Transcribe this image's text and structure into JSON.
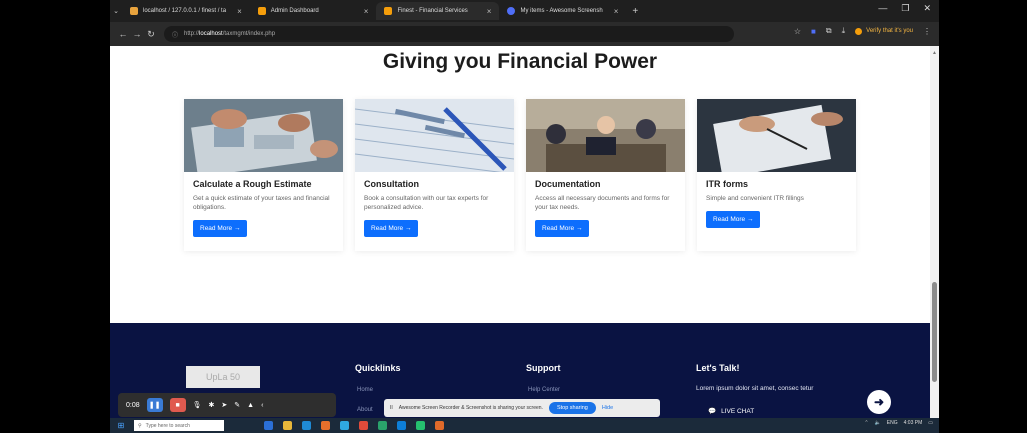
{
  "browser": {
    "tabs": [
      {
        "label": "localhost / 127.0.0.1 / finest / ta",
        "color": "#e8a33d"
      },
      {
        "label": "Admin Dashboard",
        "color": "#f59e0b"
      },
      {
        "label": "Finest - Financial Services",
        "color": "#f59e0b"
      },
      {
        "label": "My items - Awesome Screensh",
        "color": "#4f6ef7"
      }
    ],
    "url_prefix": "http://",
    "url_host": "localhost",
    "url_path": "/taxmgmt/index.php",
    "verify_label": "Verify that it's you"
  },
  "section": {
    "title": "Giving you Financial Power"
  },
  "cards": [
    {
      "title": "Calculate a Rough Estimate",
      "desc": "Get a quick estimate of your taxes and financial obligations.",
      "button": "Read More →"
    },
    {
      "title": "Consultation",
      "desc": "Book a consultation with our tax experts for personalized advice.",
      "button": "Read More →"
    },
    {
      "title": "Documentation",
      "desc": "Access all necessary documents and forms for your tax needs.",
      "button": "Read More →"
    },
    {
      "title": "ITR forms",
      "desc": "Simple and convenient ITR fillings",
      "button": "Read More →"
    }
  ],
  "footer": {
    "logo_text": "UpLa 50",
    "quicklinks_title": "Quicklinks",
    "quicklinks": [
      "Home",
      "About"
    ],
    "support_title": "Support",
    "support_items": [
      "Help Center"
    ],
    "talk_title": "Let's Talk!",
    "talk_text": "Lorem ipsum dolor sit amet, consec tetur",
    "live_chat": "LIVE CHAT"
  },
  "recorder": {
    "time": "0:08",
    "share_text": "Awesome Screen Recorder & Screenshot is sharing your screen.",
    "stop_label": "Stop sharing",
    "hide_label": "Hide"
  },
  "taskbar": {
    "search_placeholder": "Type here to search",
    "lang": "ENG",
    "time": "4:03 PM"
  },
  "colors": {
    "accent": "#0d6efd",
    "footer_bg": "#0a1342"
  }
}
